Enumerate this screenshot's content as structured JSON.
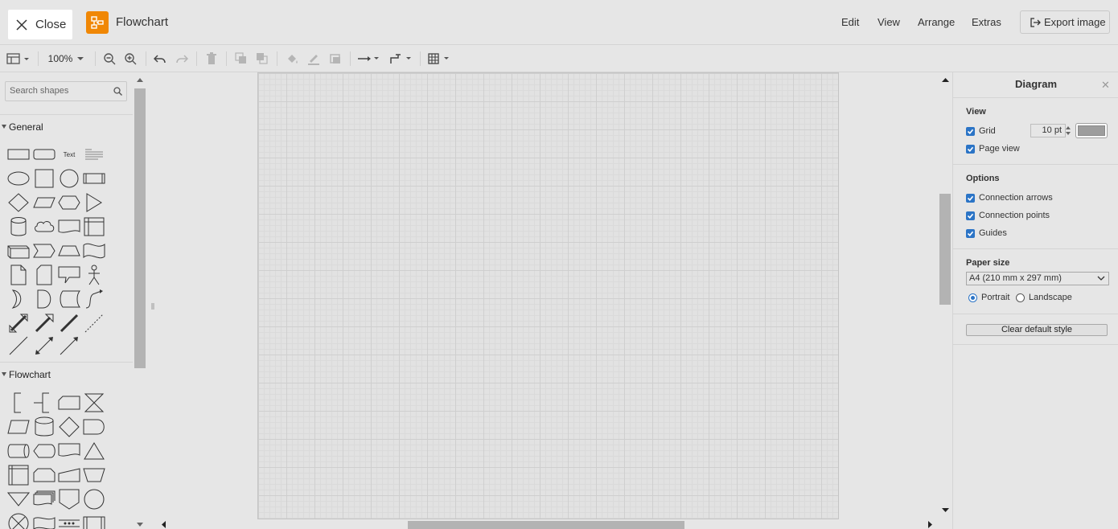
{
  "header": {
    "close_label": "Close",
    "title": "Flowchart",
    "menu": [
      "Edit",
      "View",
      "Arrange",
      "Extras"
    ],
    "export_label": "Export image",
    "logo_color": "#f08705"
  },
  "toolbar": {
    "zoom": "100%"
  },
  "sidebar": {
    "search_placeholder": "Search shapes",
    "sections": [
      "General",
      "Flowchart"
    ],
    "text_shape_label": "Text"
  },
  "panel": {
    "title": "Diagram",
    "view_heading": "View",
    "grid_label": "Grid",
    "grid_size": "10 pt",
    "page_view_label": "Page view",
    "options_heading": "Options",
    "connection_arrows": "Connection arrows",
    "connection_points": "Connection points",
    "guides": "Guides",
    "paper_heading": "Paper size",
    "paper_value": "A4 (210 mm x 297 mm)",
    "portrait": "Portrait",
    "landscape": "Landscape",
    "clear_default_style": "Clear default style",
    "accent_color": "#2b74c6"
  }
}
